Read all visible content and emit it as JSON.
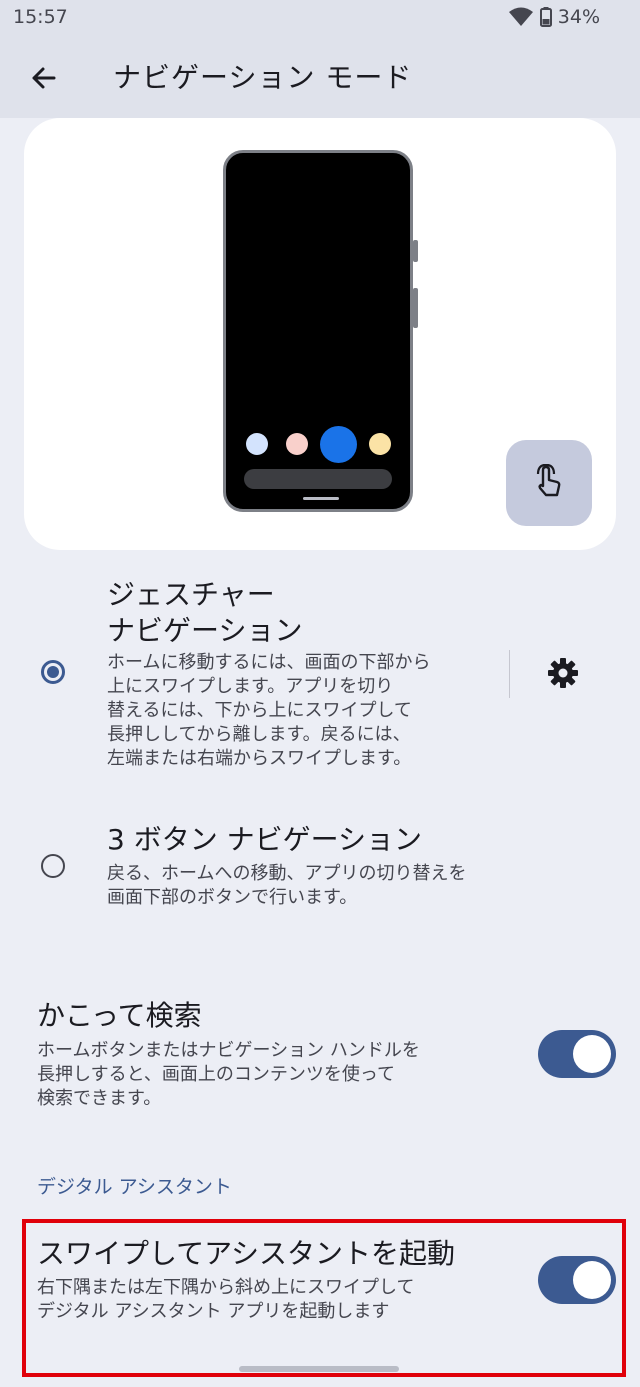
{
  "status_bar": {
    "time": "15:57",
    "battery": "34%"
  },
  "app_bar": {
    "title": "ナビゲーション モード"
  },
  "preview": {
    "dot_colors": [
      "#d3e3fd",
      "#f9d0cb",
      "#1a73e8",
      "#fbe3a6"
    ],
    "accent": "#3c5a91"
  },
  "options": [
    {
      "title_line1": "ジェスチャー",
      "title_line2": "ナビゲーション",
      "desc": [
        "ホームに移動するには、画面の下部から",
        "上にスワイプします。アプリを切り",
        "替えるには、下から上にスワイプして",
        "長押ししてから離します。戻るには、",
        "左端または右端からスワイプします。"
      ],
      "selected": true
    },
    {
      "title": "3 ボタン ナビゲーション",
      "desc": [
        "戻る、ホームへの移動、アプリの切り替えを",
        "画面下部のボタンで行います。"
      ],
      "selected": false
    }
  ],
  "circle_search": {
    "title": "かこって検索",
    "desc": [
      "ホームボタンまたはナビゲーション ハンドルを",
      "長押しすると、画面上のコンテンツを使って",
      "検索できます。"
    ],
    "enabled": true
  },
  "section": {
    "label": "デジタル アシスタント"
  },
  "swipe_assistant": {
    "title": "スワイプしてアシスタントを起動",
    "desc": [
      "右下隅または左下隅から斜め上にスワイプして",
      "デジタル アシスタント アプリを起動します"
    ],
    "enabled": true
  }
}
